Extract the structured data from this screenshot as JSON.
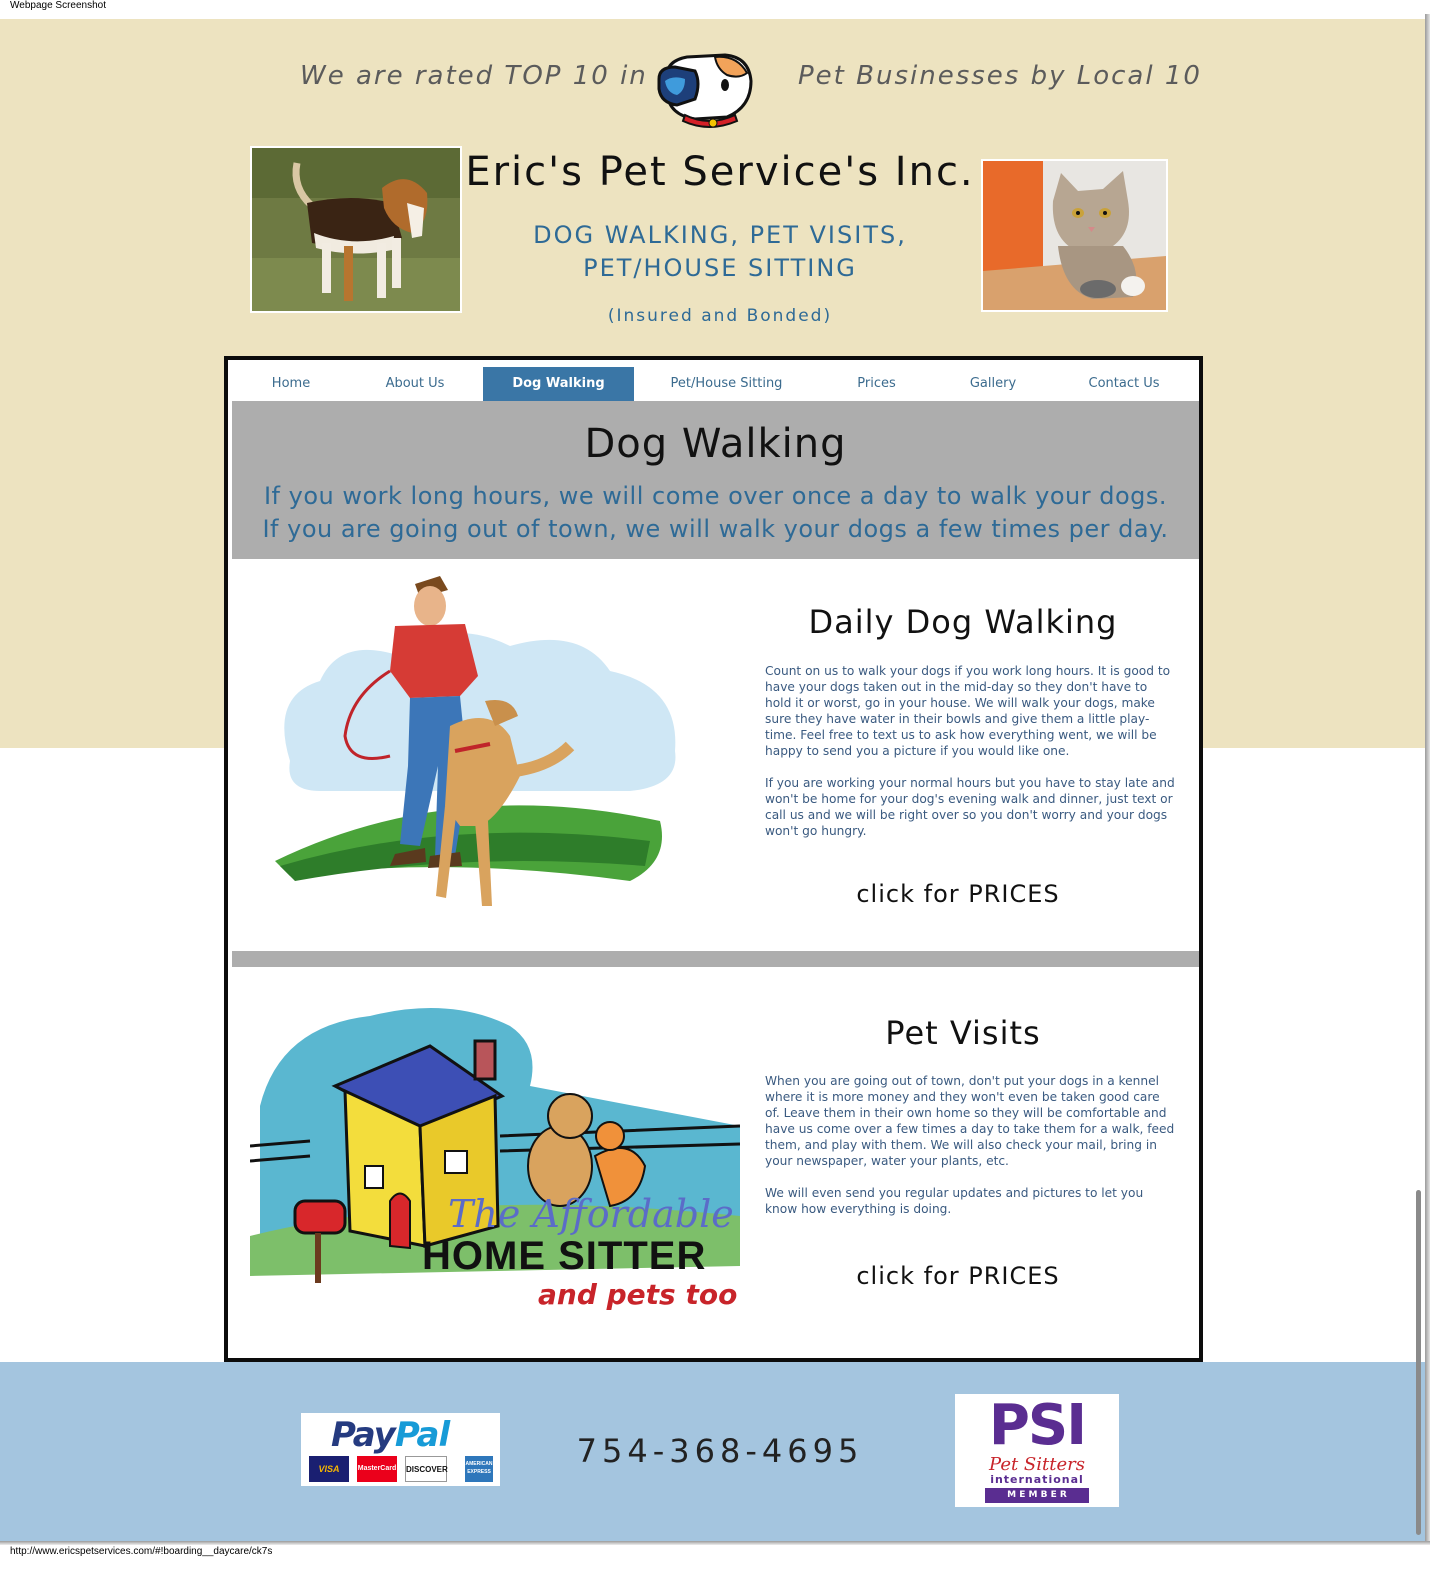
{
  "screenshot": {
    "caption": "Webpage Screenshot",
    "status_url": "http://www.ericspetservices.com/#!boarding__daycare/ck7s"
  },
  "header": {
    "rated_left": "We are rated TOP 10 in",
    "rated_right": "Pet Businesses by Local 10",
    "title": "Eric's Pet Service's Inc.",
    "services_line1": "DOG WALKING, PET VISITS,",
    "services_line2": "PET/HOUSE SITTING",
    "insured": "(Insured and Bonded)"
  },
  "nav": {
    "items": [
      {
        "label": "Home"
      },
      {
        "label": "About Us"
      },
      {
        "label": "Dog Walking",
        "active": true
      },
      {
        "label": "Pet/House Sitting"
      },
      {
        "label": "Prices"
      },
      {
        "label": "Gallery"
      },
      {
        "label": "Contact Us"
      }
    ]
  },
  "main": {
    "heading": "Dog Walking",
    "intro_line1": "If you work long hours, we will come over once a day to walk your dogs.",
    "intro_line2": "If you are going out of town, we will walk your dogs a few times per day.",
    "sections": [
      {
        "title": "Daily Dog Walking",
        "paragraphs": [
          "Count on us to walk your dogs if you work long hours.  It is good to have your dogs taken out in the mid-day so they don't have to hold it or worst, go in your house.  We will walk your dogs, make sure they have water in their bowls and give them a little play-time.  Feel free to text us to ask how everything went, we will be happy to send you a picture if you would like one.",
          "If you are working your normal hours but you have to stay late and won't be home for your dog's evening walk and dinner, just text or call us and we will be right over so you don't worry and your dogs won't go hungry."
        ],
        "link": "click for PRICES"
      },
      {
        "title": "Pet Visits",
        "paragraphs": [
          "When you are going out of town, don't put your dogs in a kennel where it is more money and they won't even be taken good care of.  Leave them in their own home so they will be comfortable and have us come over a few times a day to take them for a walk, feed them, and play with them.  We will also check your mail, bring in your newspaper, water your plants, etc.",
          "We will even send you regular updates and pictures to let you know how everything is doing."
        ],
        "link": "click for PRICES"
      }
    ],
    "home_sitter_art": {
      "line1": "The Affordable",
      "line2": "HOME SITTER",
      "line3": "and pets too"
    }
  },
  "footer": {
    "phone": "754-368-4695",
    "paypal": {
      "word_pay": "Pay",
      "word_pal": "Pal",
      "cards": [
        "VISA",
        "MasterCard",
        "DISCOVER",
        "AMERICAN EXPRESS"
      ]
    },
    "psi": {
      "letters": "PSI",
      "line1": "Pet Sitters",
      "line2": "international",
      "line3": "M E M B E R"
    }
  },
  "colors": {
    "hero_bg": "#ede3c0",
    "accent_blue": "#2e6a96",
    "nav_active": "#3a76a6",
    "band_gray": "#adadad",
    "footer_bg": "#a4c5df"
  }
}
